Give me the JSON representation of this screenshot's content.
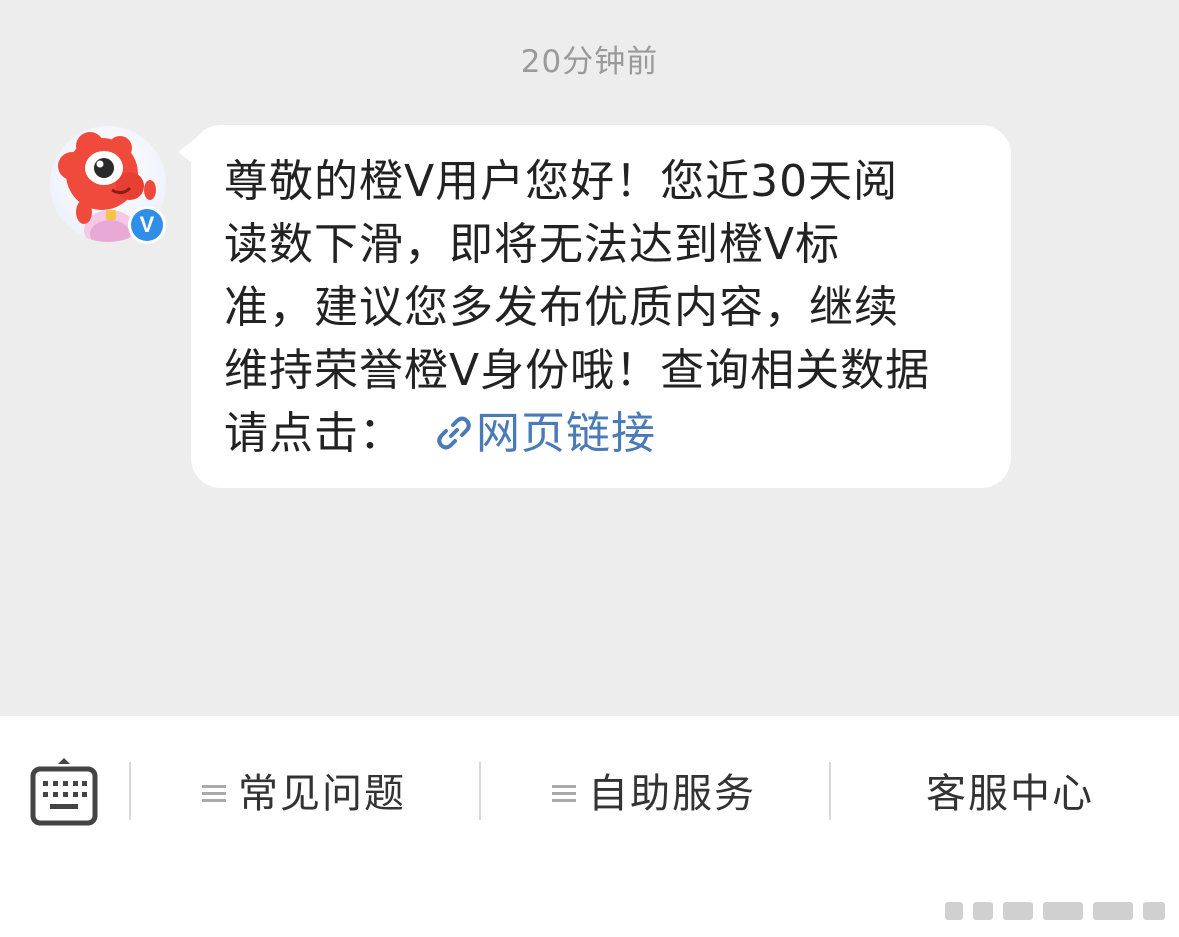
{
  "chat": {
    "timestamp": "20分钟前",
    "message": {
      "lines": [
        "尊敬的橙V用户您好！您近30天阅",
        "读数下滑，即将无法达到橙V标",
        "准，建议您多发布优质内容，继续",
        "维持荣誉橙V身份哦！查询相关数据"
      ],
      "last_line_prefix": "请点击：",
      "link_text": "网页链接"
    },
    "sender": {
      "avatar_icon": "mascot-avatar-icon",
      "badge_text": "V",
      "badge_color": "#2f8fe8"
    }
  },
  "bottom_bar": {
    "keyboard_icon": "keyboard-icon",
    "menu_items": [
      {
        "label": "常见问题",
        "has_menu_icon": true
      },
      {
        "label": "自助服务",
        "has_menu_icon": true
      },
      {
        "label": "客服中心",
        "has_menu_icon": false
      }
    ]
  },
  "colors": {
    "chat_background": "#ededed",
    "bubble_background": "#ffffff",
    "link": "#4a7bb8",
    "timestamp": "#9a9a9a"
  }
}
